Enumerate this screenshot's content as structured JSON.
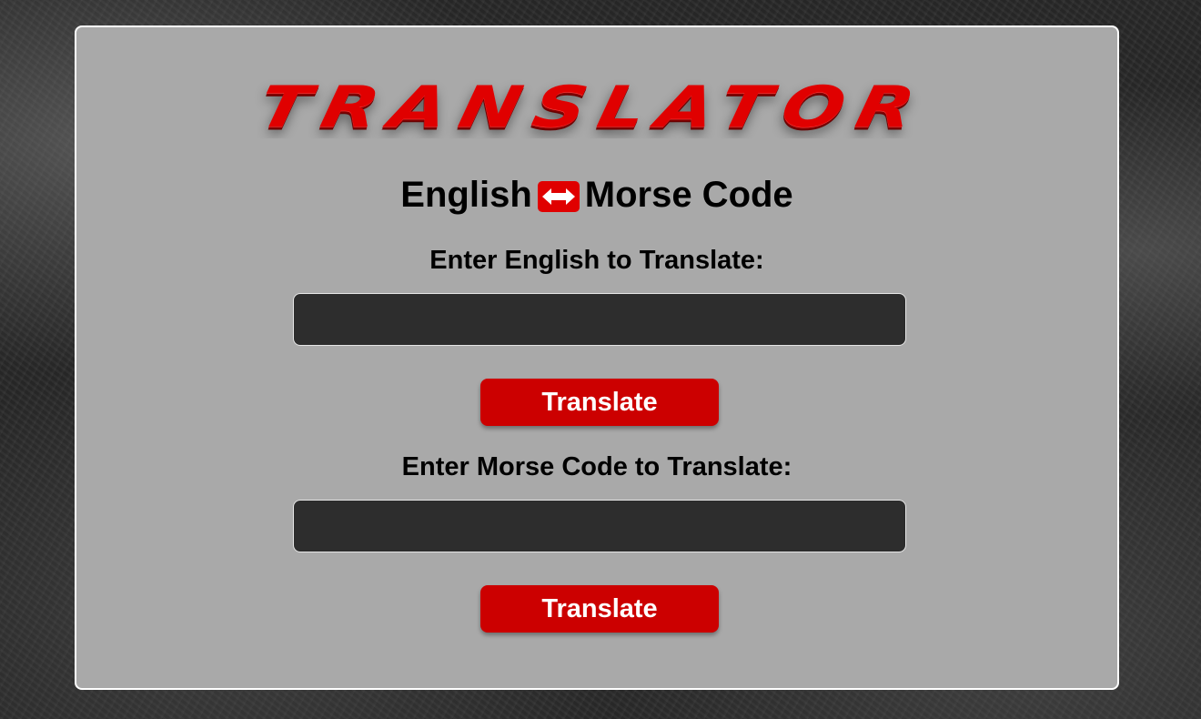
{
  "header": {
    "logo_text": "TRANSLATOR",
    "subtitle_left": "English",
    "subtitle_icon": "swap-arrows-icon",
    "subtitle_right": "Morse Code"
  },
  "english_section": {
    "label": "Enter English to Translate:",
    "input_value": "",
    "input_placeholder": "",
    "button_label": "Translate"
  },
  "morse_section": {
    "label": "Enter Morse Code to Translate:",
    "input_value": "",
    "input_placeholder": "",
    "button_label": "Translate"
  },
  "colors": {
    "accent": "#cc0000",
    "panel": "#a9a9a9",
    "input_bg": "#2d2d2d"
  }
}
